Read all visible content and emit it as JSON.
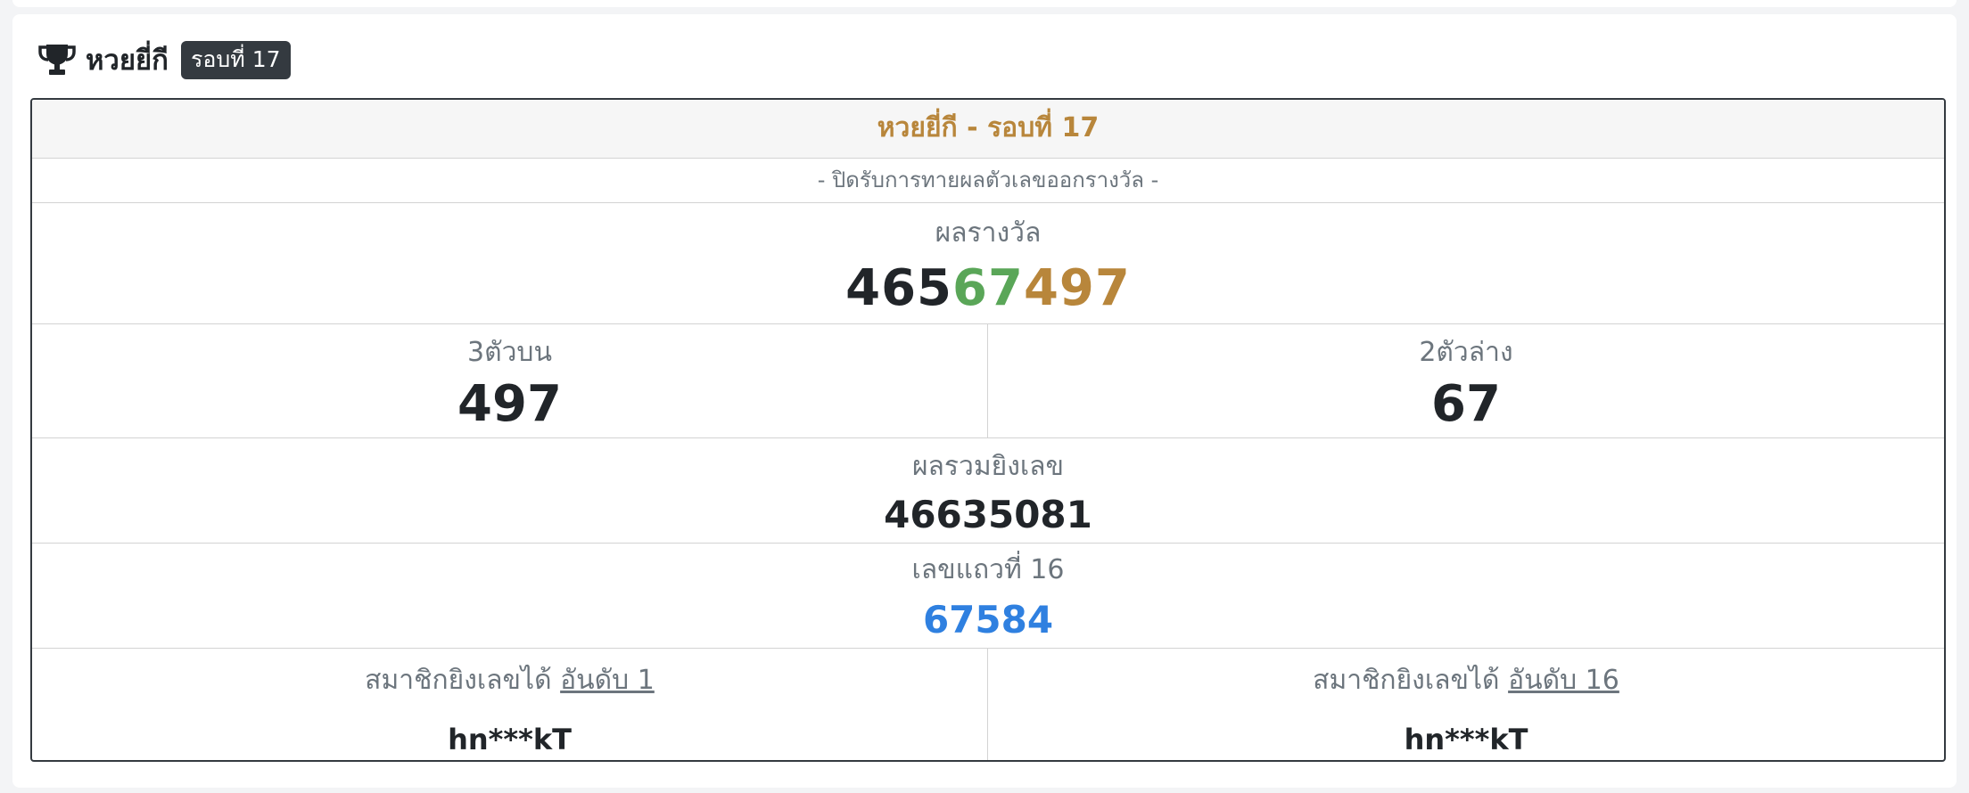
{
  "header": {
    "title": "หวยยี่กี",
    "round_badge": "รอบที่ 17"
  },
  "result": {
    "title": "หวยยี่กี - รอบที่ 17",
    "status": "- ปิดรับการทายผลตัวเลขออกรางวัล -",
    "prize_label": "ผลรางวัล",
    "prize_number_parts": [
      "465",
      "67",
      "497"
    ],
    "three_top_label": "3ตัวบน",
    "three_top_value": "497",
    "two_bottom_label": "2ตัวล่าง",
    "two_bottom_value": "67",
    "sum_label": "ผลรวมยิงเลข",
    "sum_value": "46635081",
    "line_label": "เลขแถวที่ 16",
    "line_value": "67584",
    "member_label": "สมาชิกยิงเลขได้",
    "members": [
      {
        "rank": "อันดับ 1",
        "name": "hn***kT"
      },
      {
        "rank": "อันดับ 16",
        "name": "hn***kT"
      }
    ]
  },
  "colors": {
    "accent_gold": "#b8863b",
    "accent_green": "#5aa658",
    "accent_blue": "#2f80e0",
    "badge_dark": "#343a40"
  },
  "icons": {
    "header_icon": "trophy-icon"
  }
}
